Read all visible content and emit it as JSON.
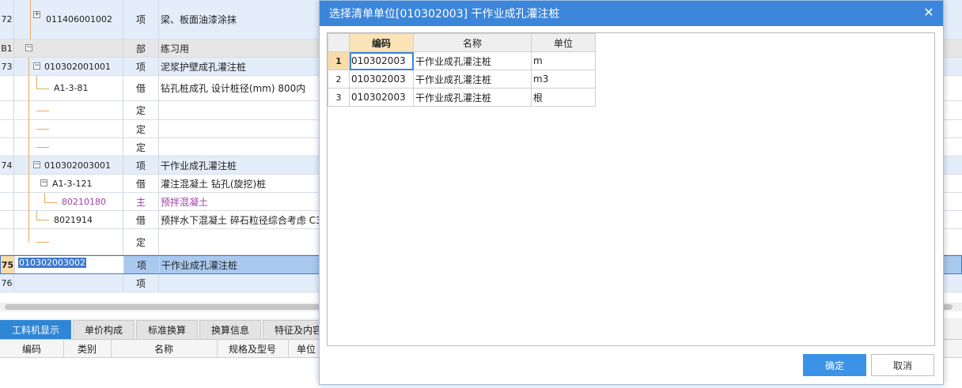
{
  "grid_rows": [
    {
      "num": "72",
      "code": "011406001002",
      "type": "项",
      "name": "梁、板面油漆涂抹",
      "kind": "item"
    },
    {
      "num": "B1",
      "code": "",
      "type": "部",
      "name": "练习用",
      "kind": "part"
    },
    {
      "num": "73",
      "code": "010302001001",
      "type": "项",
      "name": "泥浆护壁成孔灌注桩",
      "kind": "item"
    },
    {
      "num": "",
      "code": "A1-3-81",
      "type": "借",
      "name": "钻孔桩成孔 设计桩径(mm) 800内",
      "kind": "sub"
    },
    {
      "num": "",
      "code": "",
      "type": "定",
      "name": "",
      "kind": "sub"
    },
    {
      "num": "",
      "code": "",
      "type": "定",
      "name": "",
      "kind": "sub"
    },
    {
      "num": "",
      "code": "",
      "type": "定",
      "name": "",
      "kind": "sub"
    },
    {
      "num": "74",
      "code": "010302003001",
      "type": "项",
      "name": "干作业成孔灌注桩",
      "kind": "item"
    },
    {
      "num": "",
      "code": "A1-3-121",
      "type": "借",
      "name": "灌注混凝土 钻孔(旋挖)桩",
      "kind": "sub"
    },
    {
      "num": "",
      "code": "80210180",
      "type": "主",
      "name": "预拌混凝土",
      "kind": "sub"
    },
    {
      "num": "",
      "code": "8021914",
      "type": "借",
      "name": "预拌水下混凝土 碎石粒径综合考虑 C3",
      "kind": "sub"
    },
    {
      "num": "",
      "code": "",
      "type": "定",
      "name": "",
      "kind": "sub"
    },
    {
      "num": "75",
      "code": "010302003002",
      "type": "项",
      "name": "干作业成孔灌注桩",
      "kind": "sel"
    },
    {
      "num": "76",
      "code": "",
      "type": "项",
      "name": "",
      "kind": "item"
    }
  ],
  "tabs": [
    "工料机显示",
    "单价构成",
    "标准换算",
    "换算信息",
    "特征及内容"
  ],
  "sub_headers": [
    "编码",
    "类别",
    "名称",
    "规格及型号",
    "单位"
  ],
  "dialog": {
    "title": "选择清单单位[010302003] 干作业成孔灌注桩",
    "close_icon": "close-icon",
    "columns": [
      "编码",
      "名称",
      "单位"
    ],
    "rows": [
      {
        "no": "1",
        "code": "010302003",
        "name": "干作业成孔灌注桩",
        "unit": "m"
      },
      {
        "no": "2",
        "code": "010302003",
        "name": "干作业成孔灌注桩",
        "unit": "m3"
      },
      {
        "no": "3",
        "code": "010302003",
        "name": "干作业成孔灌注桩",
        "unit": "根"
      }
    ],
    "ok_label": "确定",
    "cancel_label": "取消"
  }
}
